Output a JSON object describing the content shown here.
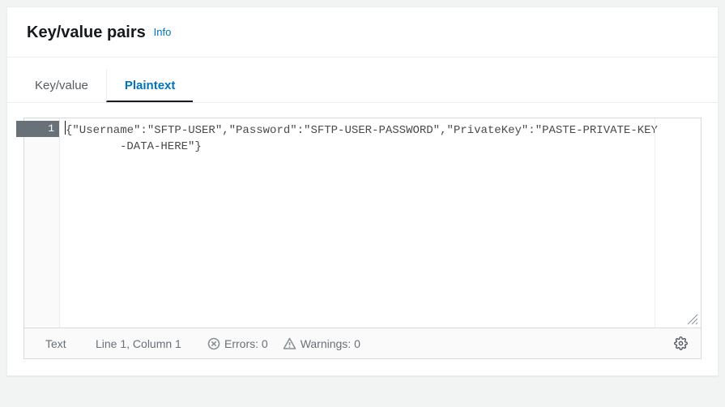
{
  "header": {
    "title": "Key/value pairs",
    "info_label": "Info"
  },
  "tabs": {
    "keyvalue": "Key/value",
    "plaintext": "Plaintext"
  },
  "editor": {
    "line_number": "1",
    "content_line1": "{\"Username\":\"SFTP-USER\",\"Password\":\"SFTP-USER-PASSWORD\",\"PrivateKey\":\"PASTE-PRIVATE-KEY",
    "content_line2": "-DATA-HERE\"}"
  },
  "status": {
    "mode": "Text",
    "position": "Line 1, Column 1",
    "errors": "Errors: 0",
    "warnings": "Warnings: 0"
  }
}
